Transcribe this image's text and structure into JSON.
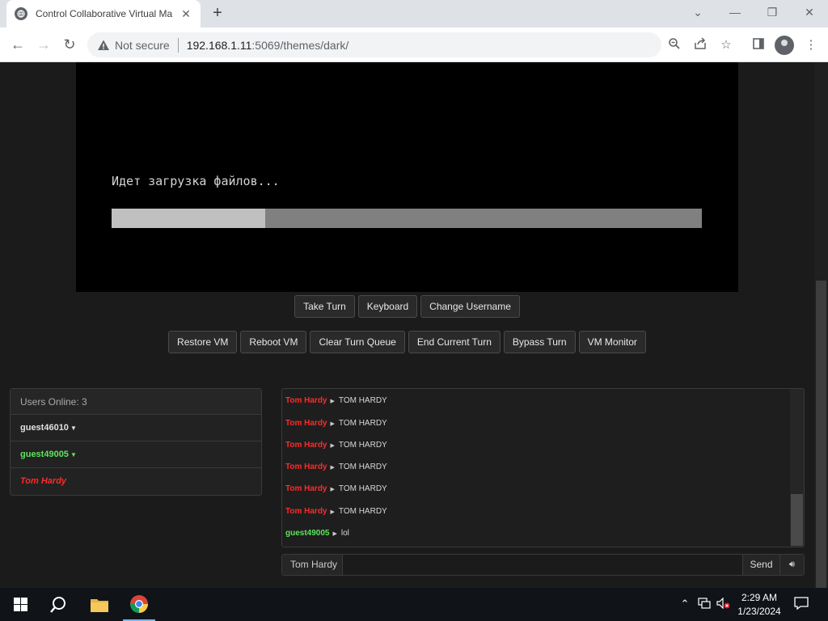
{
  "browser": {
    "tab_title": "Control Collaborative Virtual Ma",
    "tab_close": "✕",
    "new_tab": "+",
    "not_secure": "Not secure",
    "url_host": "192.168.1.11",
    "url_rest": ":5069/themes/dark/"
  },
  "vm": {
    "loading_text": "Идет загрузка файлов...",
    "progress_fraction": 0.26
  },
  "buttons_row1": [
    "Take Turn",
    "Keyboard",
    "Change Username"
  ],
  "buttons_row2": [
    "Restore VM",
    "Reboot VM",
    "Clear Turn Queue",
    "End Current Turn",
    "Bypass Turn",
    "VM Monitor"
  ],
  "users": {
    "header": "Users Online: 3",
    "list": [
      {
        "name": "guest46010",
        "color": "#e0e0e0"
      },
      {
        "name": "guest49005",
        "color": "#5ee35e"
      },
      {
        "name": "Tom Hardy",
        "color": "#ff2a2a"
      }
    ]
  },
  "chat": {
    "messages": [
      {
        "user": "Tom Hardy",
        "text": "TOM HARDY",
        "color": "#ff2a2a"
      },
      {
        "user": "Tom Hardy",
        "text": "TOM HARDY",
        "color": "#ff2a2a"
      },
      {
        "user": "Tom Hardy",
        "text": "TOM HARDY",
        "color": "#ff2a2a"
      },
      {
        "user": "Tom Hardy",
        "text": "TOM HARDY",
        "color": "#ff2a2a"
      },
      {
        "user": "Tom Hardy",
        "text": "TOM HARDY",
        "color": "#ff2a2a"
      },
      {
        "user": "Tom Hardy",
        "text": "TOM HARDY",
        "color": "#ff2a2a"
      },
      {
        "user": "guest49005",
        "text": "lol",
        "color": "#5ee35e"
      }
    ],
    "input_username": "Tom Hardy",
    "input_value": "",
    "send_label": "Send"
  },
  "taskbar": {
    "time": "2:29 AM",
    "date": "1/23/2024"
  }
}
